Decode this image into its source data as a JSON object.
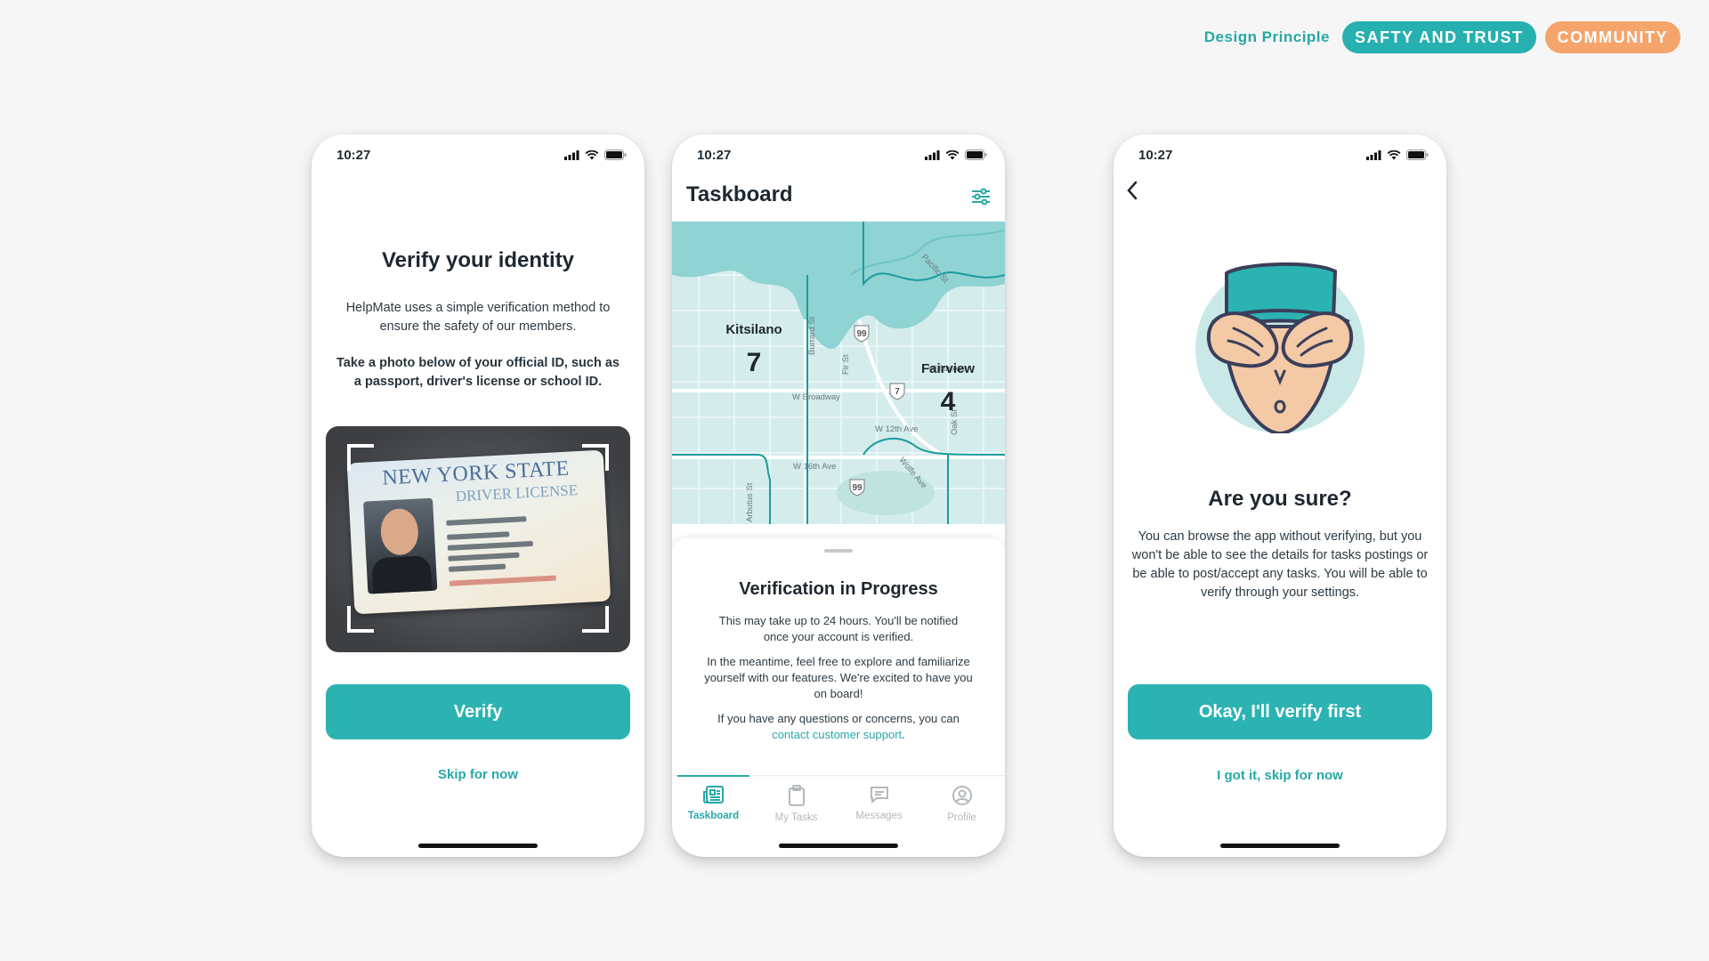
{
  "header": {
    "label": "Design Principle",
    "tags": [
      {
        "text": "SAFTY AND TRUST",
        "color": "#27b0b0"
      },
      {
        "text": "COMMUNITY",
        "color": "#f5a56b"
      }
    ]
  },
  "colors": {
    "accent": "#2bb3b2",
    "orange": "#f5a56b"
  },
  "screen1": {
    "time": "10:27",
    "title": "Verify your identity",
    "description": "HelpMate uses a simple verification method to ensure the safety of our members.",
    "instruction": "Take a photo below of your official ID, such as a passport, driver's license or school ID.",
    "id_card": {
      "state": "NEW YORK STATE",
      "type": "DRIVER LICENSE"
    },
    "primary_button": "Verify",
    "secondary_link": "Skip for now"
  },
  "screen2": {
    "time": "10:27",
    "title": "Taskboard",
    "map": {
      "areas": [
        {
          "name": "Kitsilano",
          "count": "7"
        },
        {
          "name": "Fairview",
          "count": "4"
        }
      ],
      "streets": [
        "Pacific St",
        "W 6th Ave",
        "W Broadway",
        "W 12th Ave",
        "W 16th Ave",
        "Burrard St",
        "Fir St",
        "Arbutus St",
        "Oak St",
        "Wolfe Ave"
      ],
      "route_shields": [
        "99",
        "7",
        "99"
      ]
    },
    "sheet": {
      "title": "Verification in Progress",
      "p1": "This may take up to 24 hours. You'll be notified once your account is verified.",
      "p2": "In the meantime, feel free to explore and familiarize yourself with our features. We're excited to have you on board!",
      "p3_prefix": "If you have any questions or concerns, you can",
      "p3_link": "contact customer support",
      "p3_suffix": "."
    },
    "tabs": [
      {
        "label": "Taskboard",
        "icon": "newspaper-icon",
        "active": true
      },
      {
        "label": "My Tasks",
        "icon": "clipboard-icon",
        "active": false
      },
      {
        "label": "Messages",
        "icon": "chat-icon",
        "active": false
      },
      {
        "label": "Profile",
        "icon": "profile-icon",
        "active": false
      }
    ]
  },
  "screen3": {
    "time": "10:27",
    "title": "Are you sure?",
    "description": "You can browse the app without verifying, but you won't be able to see the details for tasks postings or be able to post/accept any tasks. You will be able to verify through your settings.",
    "primary_button": "Okay, I'll verify first",
    "secondary_link": "I got it, skip for now"
  }
}
